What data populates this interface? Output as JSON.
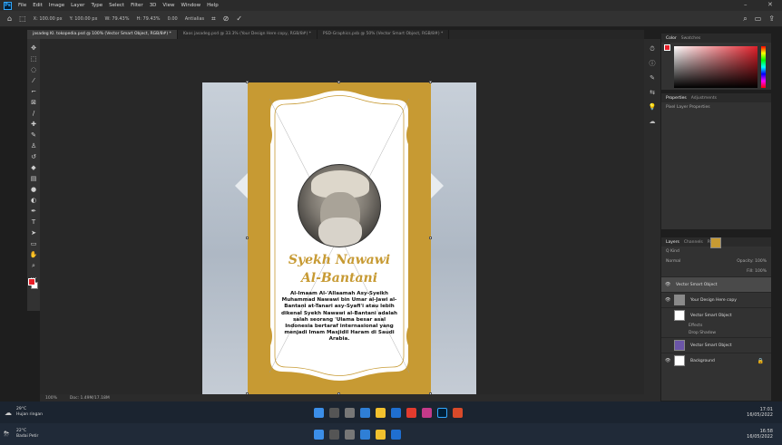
{
  "menubar": {
    "app_logo": "Ps",
    "items": [
      "File",
      "Edit",
      "Image",
      "Layer",
      "Type",
      "Select",
      "Filter",
      "3D",
      "View",
      "Window",
      "Help"
    ]
  },
  "optbar": {
    "x": "X: 100.00 px",
    "y": "Y: 100.00 px",
    "w": "W: 79.43%",
    "h": "H: 79.43%",
    "angle": "0.00",
    "interp": "Antialias"
  },
  "tabs": [
    "jasadeg Kl. tokopedia.psd @ 100% (Vector Smart Object, RGB/8#) *",
    "Kaos jasadeg.psd @ 33.3% (Your Design Here copy, RGB/8#) *",
    "PSD-Graphics.psb @ 50% (Vector Smart Object, RGB/8#) *"
  ],
  "tools": [
    "move-icon",
    "marquee-icon",
    "lasso-icon",
    "magic-wand-icon",
    "crop-icon",
    "frame-icon",
    "eyedropper-icon",
    "healing-icon",
    "brush-icon",
    "stamp-icon",
    "history-brush-icon",
    "eraser-icon",
    "gradient-icon",
    "blur-icon",
    "dodge-icon",
    "pen-icon",
    "type-icon",
    "path-select-icon",
    "shape-icon",
    "hand-icon",
    "zoom-icon",
    "more-icon"
  ],
  "canvas": {
    "title_line1": "Syekh Nawawi",
    "title_line2": "Al-Bantani",
    "body": "Al-Imaam Al-'Allaamah Asy-Syeikh Muhammad Nawawi bin Umar al-Jawi al-Bantani at-Tanari asy-Syafi'i atau lebih dikenal Syekh Nawawi al-Bantani adalah salah seorang 'Ulama besar asal Indonesia bertaraf internasional yang menjadi Imam Masjidil Haram di Saudi Arabia."
  },
  "status": {
    "zoom": "100%",
    "doc": "Doc: 1.49M/17.18M"
  },
  "color_panel": {
    "tab1": "Color",
    "tab2": "Swatches"
  },
  "properties_panel": {
    "tab1": "Properties",
    "tab2": "Adjustments",
    "row": "Pixel Layer Properties"
  },
  "layers_panel": {
    "tab1": "Layers",
    "tab2": "Channels",
    "tab3": "Paths",
    "kind": "Q Kind",
    "blend": "Normal",
    "opacity": "Opacity: 100%",
    "fill": "Fill: 100%",
    "layers": [
      {
        "name": "Vector Smart Object",
        "thumb": "gold",
        "selected": true
      },
      {
        "name": "Your Design Here copy",
        "thumb": "photo",
        "selected": false
      },
      {
        "name": "Vector Smart Object",
        "thumb": "white",
        "selected": false
      },
      {
        "name": "Vector Smart Object",
        "thumb": "purple",
        "selected": false
      },
      {
        "name": "Background",
        "thumb": "white",
        "selected": false
      }
    ],
    "effects_label": "Effects",
    "drop_shadow_label": "Drop Shadow"
  },
  "taskbar_upper": {
    "temp": "29°C",
    "weather": "Hujan ringan",
    "time": "17:01",
    "date": "16/05/2022"
  },
  "taskbar_lower": {
    "temp": "22°C",
    "weather": "Badai Petir",
    "time": "16:58",
    "date": "16/05/2022"
  },
  "colors": {
    "gold": "#c79a33",
    "accent": "#31a8ff",
    "foreground": "#e8202a"
  }
}
